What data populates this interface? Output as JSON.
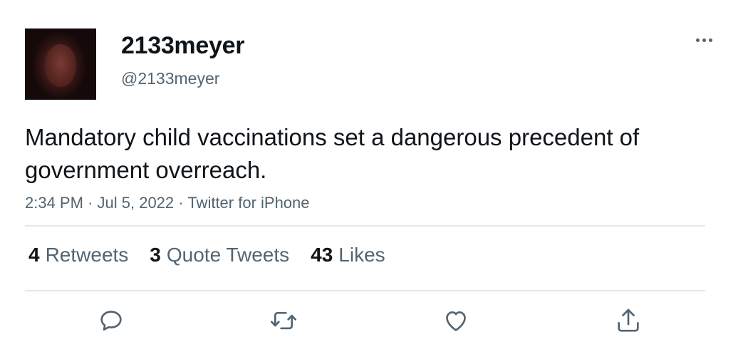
{
  "user": {
    "display_name": "2133meyer",
    "handle": "@2133meyer"
  },
  "tweet": {
    "text": "Mandatory child vaccinations set a dangerous precedent of government overreach.",
    "time": "2:34 PM",
    "date": "Jul 5, 2022",
    "source": "Twitter for iPhone"
  },
  "stats": {
    "retweets": {
      "count": "4",
      "label": "Retweets"
    },
    "quotes": {
      "count": "3",
      "label": "Quote Tweets"
    },
    "likes": {
      "count": "43",
      "label": "Likes"
    }
  },
  "icons": {
    "more": "more-horizontal-icon",
    "reply": "reply-icon",
    "retweet": "retweet-icon",
    "like": "heart-icon",
    "share": "share-icon"
  },
  "colors": {
    "text_primary": "#0f1419",
    "text_secondary": "#536471",
    "divider": "#e4e7ea"
  }
}
